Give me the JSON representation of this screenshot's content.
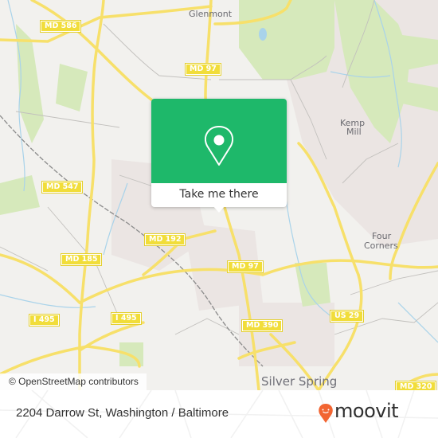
{
  "map": {
    "place_labels": [
      {
        "id": "glenmont",
        "text": "Glenmont"
      },
      {
        "id": "kemp-mill-1",
        "text": "Kemp"
      },
      {
        "id": "kemp-mill-2",
        "text": "Mill"
      },
      {
        "id": "four-corners-1",
        "text": "Four"
      },
      {
        "id": "four-corners-2",
        "text": "Corners"
      },
      {
        "id": "silver-spring",
        "text": "Silver Spring"
      }
    ],
    "road_shields": [
      {
        "id": "md586",
        "text": "MD 586"
      },
      {
        "id": "md97-north",
        "text": "MD 97"
      },
      {
        "id": "md547",
        "text": "MD 547"
      },
      {
        "id": "md192",
        "text": "MD 192"
      },
      {
        "id": "md185",
        "text": "MD 185"
      },
      {
        "id": "md97-south",
        "text": "MD 97"
      },
      {
        "id": "i495-west",
        "text": "I 495"
      },
      {
        "id": "i495-east",
        "text": "I 495"
      },
      {
        "id": "md390",
        "text": "MD 390"
      },
      {
        "id": "us29",
        "text": "US 29"
      },
      {
        "id": "md320",
        "text": "MD 320"
      }
    ],
    "attribution": "© OpenStreetMap contributors",
    "colors": {
      "background": "#f2f1ee",
      "road_major": "#f7e06a",
      "park": "#d4e9b8",
      "water": "#a9d3ea",
      "urban": "#ece6e4"
    }
  },
  "popup": {
    "icon": "map-pin-icon",
    "button_label": "Take me there",
    "color": "#1eb86a"
  },
  "footer": {
    "address": "2204 Darrow St, Washington / Baltimore",
    "logo_text": "moovit",
    "logo_icon": "moovit-pin-smile-icon",
    "logo_color": "#f26532"
  }
}
